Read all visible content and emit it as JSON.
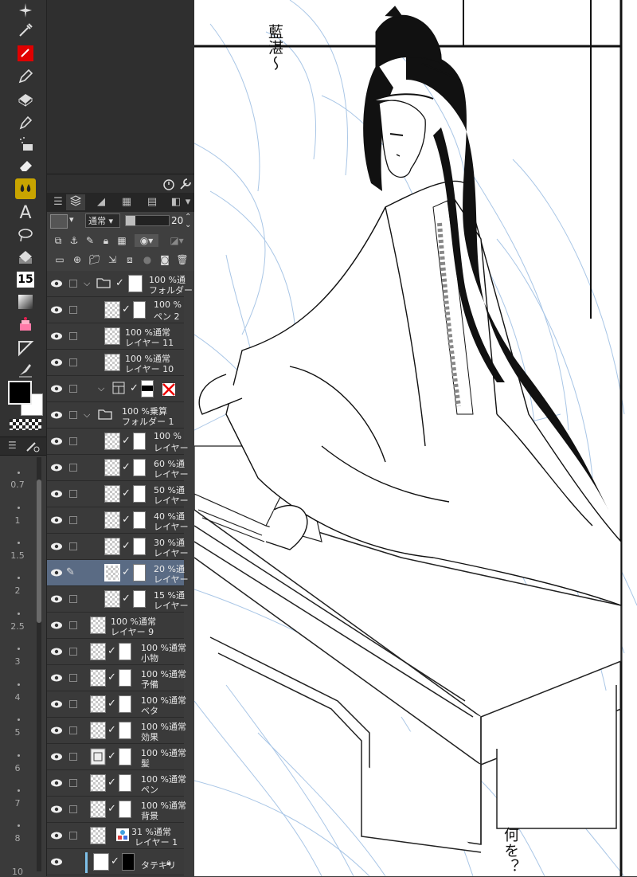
{
  "toolbar": {
    "tools": [
      "sparkle-icon",
      "eyedropper-icon",
      "red-fill-icon",
      "pen-icon",
      "eraser-block-icon",
      "pencil-icon",
      "airbrush-icon",
      "eraser-icon",
      "blend-drops-icon",
      "text-icon",
      "lasso-icon",
      "fill-bucket-icon",
      "frame-15-icon",
      "gradient-icon",
      "cake-icon",
      "figure-ruler-icon",
      "correction-brush-icon"
    ],
    "frame_number": "15",
    "text_tool": "A",
    "brush_sizes": [
      "0.7",
      "1",
      "1.5",
      "2",
      "2.5",
      "3",
      "4",
      "5",
      "6",
      "7",
      "8",
      "10"
    ],
    "colors": {
      "main": "#000000",
      "sub": "#ffffff",
      "accent": "#c8a400",
      "red": "#e00000"
    }
  },
  "layer_panel": {
    "blend_mode": "通常",
    "opacity": "20",
    "layers": [
      {
        "line1": "100 %通",
        "line2": "フォルダー"
      },
      {
        "line1": "100 %",
        "line2": "ペン 2"
      },
      {
        "line1": "100 %通常",
        "line2": "レイヤー 11"
      },
      {
        "line1": "100 %通常",
        "line2": "レイヤー 10"
      },
      {
        "line1": "",
        "line2": ""
      },
      {
        "line1": "100 %乗算",
        "line2": "フォルダー 1"
      },
      {
        "line1": "100 %",
        "line2": "レイヤー"
      },
      {
        "line1": "60 %通",
        "line2": "レイヤー"
      },
      {
        "line1": "50 %通",
        "line2": "レイヤー"
      },
      {
        "line1": "40 %通",
        "line2": "レイヤー"
      },
      {
        "line1": "30 %通",
        "line2": "レイヤー"
      },
      {
        "line1": "20 %通",
        "line2": "レイヤー"
      },
      {
        "line1": "15 %通",
        "line2": "レイヤー"
      },
      {
        "line1": "100 %通常",
        "line2": "レイヤー 9"
      },
      {
        "line1": "100 %通常",
        "line2": "小物"
      },
      {
        "line1": "100 %通常",
        "line2": "予備"
      },
      {
        "line1": "100 %通常",
        "line2": "ベタ"
      },
      {
        "line1": "100 %通常",
        "line2": "効果"
      },
      {
        "line1": "100 %通常",
        "line2": "髪"
      },
      {
        "line1": "100 %通常",
        "line2": "ペン"
      },
      {
        "line1": "100 %通常",
        "line2": "背景"
      },
      {
        "line1": "31 %通常",
        "line2": "レイヤー 1"
      },
      {
        "line1": "",
        "line2": "タテキリ"
      }
    ]
  },
  "canvas": {
    "speech_top": "藍湛〜",
    "speech_bottom": "何を？"
  }
}
